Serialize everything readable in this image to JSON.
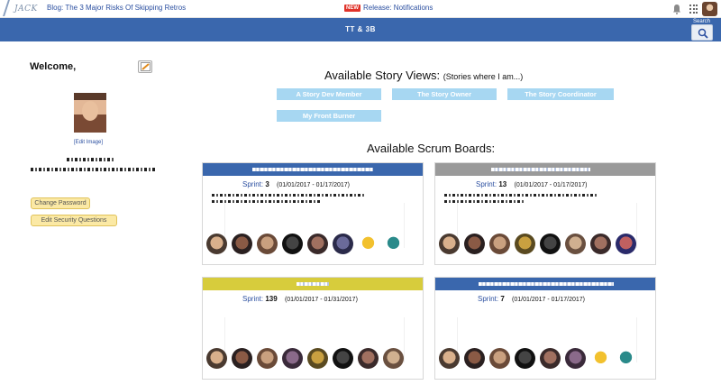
{
  "topbar": {
    "logo_text": "JACK",
    "blog_link": "Blog: The 3 Major Risks Of Skipping Retros",
    "new_badge": "NEW",
    "release_link": "Release: Notifications"
  },
  "header": {
    "title": "TT & 3B",
    "search_label": "Search"
  },
  "profile": {
    "welcome": "Welcome,",
    "edit_image": "[Edit Image]",
    "change_password": "Change Password",
    "edit_security": "Edit Security Questions"
  },
  "story_views": {
    "heading": "Available Story Views:",
    "subheading": "(Stories where I am...)",
    "buttons": [
      "A Story Dev Member",
      "The Story Owner",
      "The Story Coordinator",
      "My Front Burner"
    ]
  },
  "scrum": {
    "heading": "Available Scrum Boards:",
    "boards": [
      {
        "header_color": "#3a67ad",
        "sprint_label": "Sprint:",
        "sprint_number": "3",
        "dates": "(01/01/2017 - 01/17/2017)"
      },
      {
        "header_color": "#9a9a9a",
        "sprint_label": "Sprint:",
        "sprint_number": "13",
        "dates": "(01/01/2017 - 01/17/2017)"
      },
      {
        "header_color": "#d7cc3c",
        "sprint_label": "Sprint:",
        "sprint_number": "139",
        "dates": "(01/01/2017 - 01/31/2017)"
      },
      {
        "header_color": "#3a67ad",
        "sprint_label": "Sprint:",
        "sprint_number": "7",
        "dates": "(01/01/2017 - 01/17/2017)"
      }
    ]
  },
  "icons": {
    "bell": "bell-icon",
    "apps": "apps-grid-icon",
    "search": "search-icon",
    "edit": "edit-profile-icon"
  },
  "colors": {
    "header_blue": "#3a67ad",
    "story_button": "#a7d7f2",
    "yellow_button": "#fbe9a5"
  }
}
